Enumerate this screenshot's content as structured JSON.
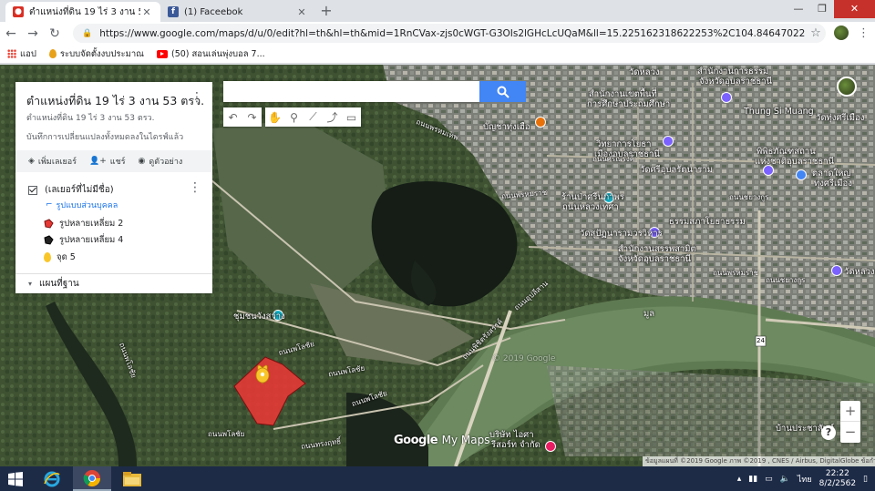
{
  "browser": {
    "tabs": [
      {
        "title": "ตำแหน่งที่ดิน 19 ไร่ 3 งาน 53 ตรว.",
        "favicon": "google-maps-pin-icon",
        "color": "#d93025"
      },
      {
        "title": "(1) Faceebok",
        "favicon": "facebook-icon",
        "color": "#3b5998"
      }
    ],
    "url": "https://www.google.com/maps/d/u/0/edit?hl=th&hl=th&mid=1RnCVax-zjs0cWGT-G3OIs2lGHcLcUQaM&ll=15.225162318622253%2C104.84647022221975&z=16",
    "bookmarks": [
      {
        "label": "แอป",
        "icon": "apps-icon"
      },
      {
        "label": "ระบบจัดตั้งงบประมาณ",
        "icon": "drop-icon"
      },
      {
        "label": "(50) สอนเล่นพุ่งบอล 7...",
        "icon": "youtube-icon"
      }
    ]
  },
  "panel": {
    "title": "ตำแหน่งที่ดิน 19 ไร่ 3 งาน 53 ตรว.",
    "subtitle": "ตำแหน่งที่ดิน 19 ไร่ 3 งาน 53 ตรว.",
    "saved": "บันทึกการเปลี่ยนแปลงทั้งหมดลงในไดรฟ์แล้ว",
    "actions": {
      "add_layer": "เพิ่มเลเยอร์",
      "share": "แชร์",
      "preview": "ดูตัวอย่าง"
    },
    "layer": {
      "name": "(เลเยอร์ที่ไม่มีชื่อ)",
      "style": "รูปแบบส่วนบุคคล",
      "features": [
        {
          "label": "รูปหลายเหลี่ยม 2",
          "color": "#e53935"
        },
        {
          "label": "รูปหลายเหลี่ยม 4",
          "color": "#000000"
        },
        {
          "label": "จุด 5",
          "color": "#f9c62a"
        }
      ]
    },
    "basemap": "แผนที่ฐาน"
  },
  "map": {
    "labels": [
      {
        "text": "ชุมชนวังสว่าง"
      },
      {
        "text": "สำนักงานการธรรม"
      },
      {
        "text": "จังหวัดอุบลราชธานี"
      },
      {
        "text": "สำนักงานเขตพื้นที่"
      },
      {
        "text": "การศึกษาประถมศึกษา"
      },
      {
        "text": "บัญชาทุ่งเฮือ"
      },
      {
        "text": "วัดหลวง"
      },
      {
        "text": "Thung Si Muang"
      },
      {
        "text": "วัดทุ่งศรีเมือง"
      },
      {
        "text": "พิพิธภัณฑสถาน"
      },
      {
        "text": "แห่งชาติอุบลราชธานี"
      },
      {
        "text": "ตลาดใหญ่"
      },
      {
        "text": "ทุ่งศรีเมือง"
      },
      {
        "text": "วิทยาการโยธา"
      },
      {
        "text": "เมืองอุบลราชธานี"
      },
      {
        "text": "วัดศรีอุบลรัตนาราม"
      },
      {
        "text": "ร้านป่าศรีนภาพร"
      },
      {
        "text": "ถนนหลวงเทศา"
      },
      {
        "text": "ธรรมสภาโยธาธรรม"
      },
      {
        "text": "วัดสุปัฏนารามวรวิหาร"
      },
      {
        "text": "สำนักงานสรรพสามิต"
      },
      {
        "text": "จังหวัดอุบลราชธานี"
      },
      {
        "text": "วัดหลวง"
      },
      {
        "text": "บ้านประชาสันต์"
      },
      {
        "text": "บริษัท ไอศา"
      },
      {
        "text": "รีสอร์ท จำกัด"
      },
      {
        "text": "มูล"
      }
    ],
    "road_labels": [
      {
        "text": "ถนนพรหมเทพ"
      },
      {
        "text": "ถนนศรีณรงค์"
      },
      {
        "text": "ถนนพรหมราช"
      },
      {
        "text": "ถนนชยางกูร"
      },
      {
        "text": "ถนนพโลชัย"
      },
      {
        "text": "ถนนพโลชัย"
      },
      {
        "text": "ถนนพโลชัย"
      },
      {
        "text": "ถนนพโลชัย"
      },
      {
        "text": "ถนนพโลชัย"
      },
      {
        "text": "ถนนทรงฤทธิ์"
      },
      {
        "text": "ถนนชยางกูร"
      },
      {
        "text": "ถนนพรหมราช"
      },
      {
        "text": "ถนนอุปลีสาน"
      },
      {
        "text": "ถนนพิชิตรังสรรค์"
      }
    ],
    "route_shield": "24",
    "watermark": "© 2019 Google",
    "logo_google": "Google",
    "logo_mymaps": "My Maps",
    "attribution": "ข้อมูลแผนที่ ©2019 Google ภาพ ©2019 , CNES / Airbus, DigitalGlobe   ข้อกำหนด"
  },
  "taskbar": {
    "time": "22:22",
    "date": "8/2/2562",
    "lang": "ไทย"
  }
}
